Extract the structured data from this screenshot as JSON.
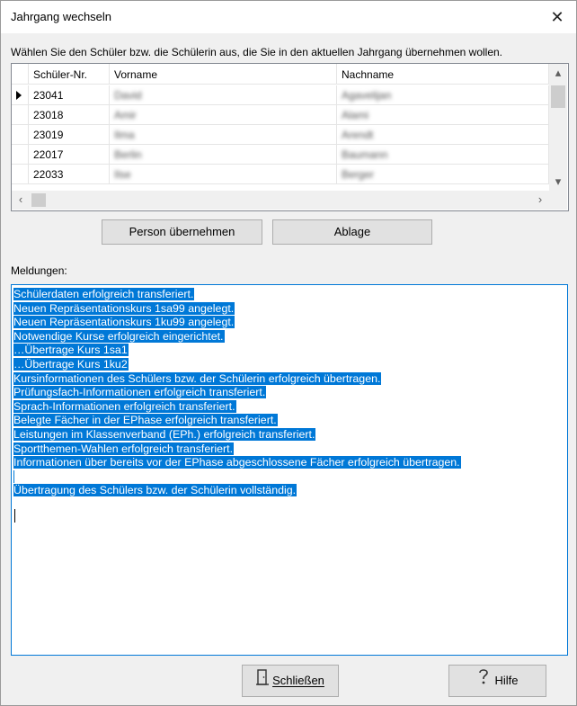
{
  "window": {
    "title": "Jahrgang wechseln",
    "close_glyph": "✕"
  },
  "instruction": "Wählen Sie den Schüler bzw. die Schülerin aus, die Sie in den aktuellen Jahrgang übernehmen wollen.",
  "grid": {
    "columns": [
      "Schüler-Nr.",
      "Vorname",
      "Nachname"
    ],
    "rows": [
      {
        "nr": "23041",
        "vorname": "David",
        "nachname": "Agavelijan",
        "selected": true
      },
      {
        "nr": "23018",
        "vorname": "Amir",
        "nachname": "Alami",
        "selected": false
      },
      {
        "nr": "23019",
        "vorname": "Ilma",
        "nachname": "Arendt",
        "selected": false
      },
      {
        "nr": "22017",
        "vorname": "Berlin",
        "nachname": "Baumann",
        "selected": false
      },
      {
        "nr": "22033",
        "vorname": "Ilse",
        "nachname": "Berger",
        "selected": false
      }
    ]
  },
  "buttons": {
    "person_uebernehmen": "Person übernehmen",
    "ablage": "Ablage",
    "schliessen": "Schließen",
    "hilfe": "Hilfe"
  },
  "messages_label": "Meldungen:",
  "messages": [
    "Schülerdaten erfolgreich transferiert.",
    "Neuen Repräsentationskurs 1sa99 angelegt.",
    "Neuen Repräsentationskurs 1ku99 angelegt.",
    "Notwendige Kurse erfolgreich eingerichtet.",
    "…Übertrage Kurs 1sa1",
    "…Übertrage Kurs 1ku2",
    "Kursinformationen des Schülers bzw. der Schülerin erfolgreich übertragen.",
    "Prüfungsfach-Informationen erfolgreich transferiert.",
    "Sprach-Informationen erfolgreich transferiert.",
    "Belegte Fächer in der EPhase erfolgreich transferiert.",
    "Leistungen im Klassenverband (EPh.) erfolgreich transferiert.",
    "Sportthemen-Wahlen erfolgreich transferiert.",
    "Informationen über bereits vor der EPhase abgeschlossene Fächer erfolgreich übertragen.",
    "",
    "Übertragung des Schülers bzw. der Schülerin vollständig."
  ],
  "icons": {
    "close": "close-icon",
    "door": "door-icon",
    "help": "help-icon",
    "row_pointer": "row-pointer-icon"
  },
  "colors": {
    "selection": "#0078d7",
    "background": "#f0f0f0"
  }
}
